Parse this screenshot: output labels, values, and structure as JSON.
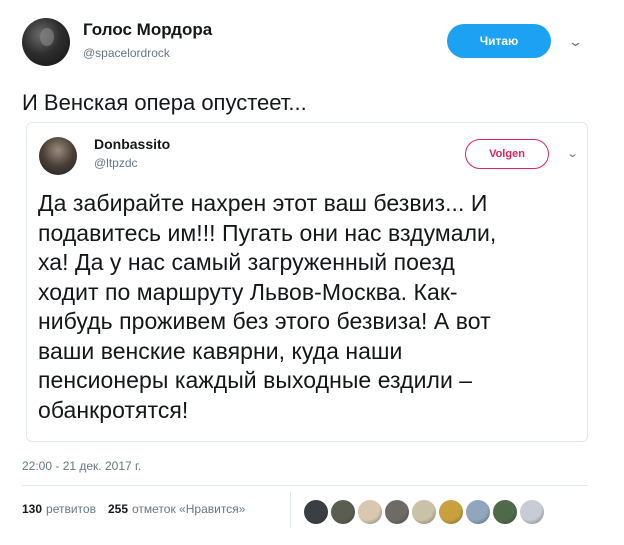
{
  "tweet": {
    "author_name": "Голос Мордора",
    "author_handle": "@spacelordrock",
    "follow_label": "Читаю",
    "text": "И Венская опера опустеет...",
    "timestamp": "22:00 - 21 дек. 2017 г."
  },
  "quoted": {
    "author_name": "Donbassito",
    "author_handle": "@ltpzdc",
    "follow_label": "Volgen",
    "lines": [
      "Да забирайте нахрен этот ваш безвиз... И",
      "подавитесь им!!! Пугать они нас вздумали,",
      "ха! Да у нас самый загруженный поезд",
      "ходит по маршруту Львов-Москва. Как-",
      "нибудь проживем без этого безвиза! А вот",
      "ваши венские кавярни, куда наши",
      "пенсионеры каждый выходные ездили –",
      "обанкротятся!"
    ]
  },
  "stats": {
    "retweets_count": "130",
    "retweets_label": "ретвитов",
    "likes_count": "255",
    "likes_label": "отметок «Нравится»"
  },
  "likers": [
    {
      "color": "#3a3f44"
    },
    {
      "color": "#5a5e52"
    },
    {
      "color": "#d9c7b0"
    },
    {
      "color": "#6e6a66"
    },
    {
      "color": "#c9c2a8"
    },
    {
      "color": "#c8a040"
    },
    {
      "color": "#8fa6bd"
    },
    {
      "color": "#4f6a48"
    },
    {
      "color": "#c7cdd4"
    }
  ],
  "colors": {
    "accent": "#1da1f2",
    "follow_outline": "#e0245e",
    "secondary_text": "#657786"
  }
}
